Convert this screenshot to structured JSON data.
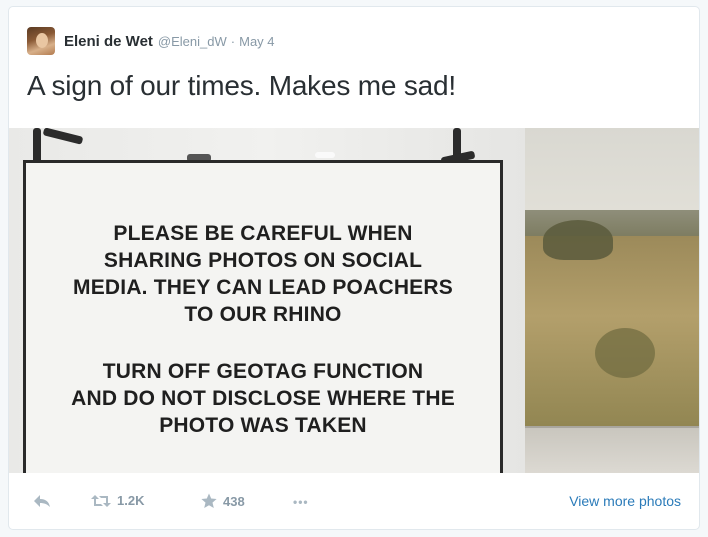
{
  "tweet": {
    "author_name": "Eleni de Wet",
    "handle": "@Eleni_dW",
    "separator": "·",
    "date": "May 4",
    "text": "A sign of our times. Makes me sad!"
  },
  "photo": {
    "sign_paragraph_1": [
      "PLEASE BE CAREFUL WHEN",
      "SHARING PHOTOS ON SOCIAL",
      "MEDIA. THEY CAN LEAD POACHERS",
      "TO OUR RHINO"
    ],
    "sign_paragraph_2": [
      "TURN OFF GEOTAG FUNCTION",
      "AND DO NOT DISCLOSE WHERE THE",
      "PHOTO WAS TAKEN"
    ]
  },
  "actions": {
    "retweet_count": "1.2K",
    "favorite_count": "438",
    "more_label": "•••",
    "view_more_label": "View more photos"
  },
  "colors": {
    "link": "#2b7bb9",
    "muted": "#8899a6",
    "text": "#292f33"
  },
  "icons": [
    "reply-icon",
    "retweet-icon",
    "star-icon",
    "more-icon"
  ]
}
